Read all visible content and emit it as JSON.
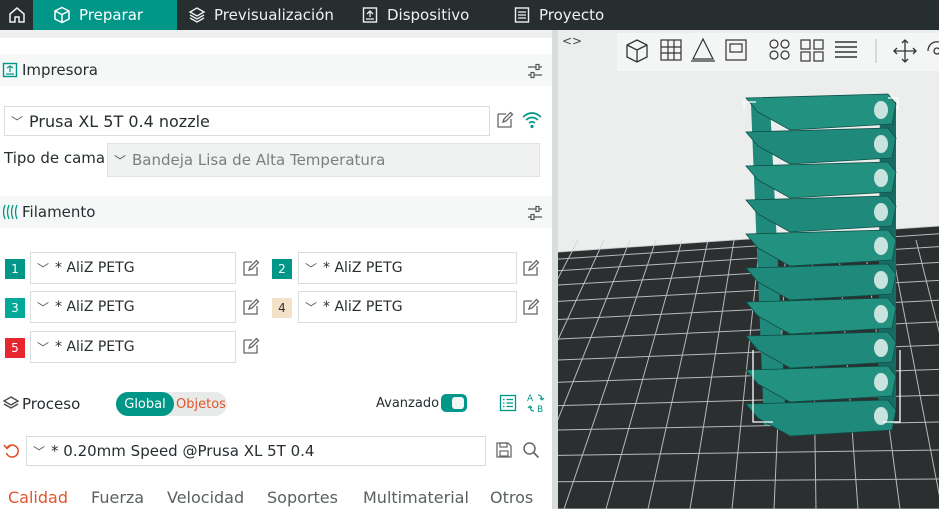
{
  "nav": {
    "tabs": [
      {
        "label": "Preparar"
      },
      {
        "label": "Previsualización"
      },
      {
        "label": "Dispositivo"
      },
      {
        "label": "Proyecto"
      }
    ]
  },
  "printer": {
    "section_label": "Impresora",
    "selected": "Prusa XL 5T 0.4 nozzle",
    "bed_label": "Tipo de cama",
    "bed_value": "Bandeja Lisa de Alta Temperatura"
  },
  "filament": {
    "section_label": "Filamento",
    "slots": [
      {
        "num": "1",
        "name": "* AliZ PETG",
        "color": "#009688"
      },
      {
        "num": "2",
        "name": "* AliZ PETG",
        "color": "#009688"
      },
      {
        "num": "3",
        "name": "* AliZ PETG",
        "color": "#00a89a"
      },
      {
        "num": "4",
        "name": "* AliZ PETG",
        "color": "#f4e2c8"
      },
      {
        "num": "5",
        "name": "* AliZ PETG",
        "color": "#e8262f"
      }
    ]
  },
  "process": {
    "section_label": "Proceso",
    "toggle_global": "Global",
    "toggle_objects": "Objetos",
    "advanced_label": "Avanzado",
    "preset": "* 0.20mm Speed @Prusa XL 5T 0.4",
    "tabs": [
      {
        "label": "Calidad"
      },
      {
        "label": "Fuerza"
      },
      {
        "label": "Velocidad"
      },
      {
        "label": "Soportes"
      },
      {
        "label": "Multimaterial"
      },
      {
        "label": "Otros"
      }
    ]
  },
  "colors": {
    "accent": "#009688",
    "active_tab_text": "#e0562d",
    "topbar_bg": "#262e30"
  }
}
